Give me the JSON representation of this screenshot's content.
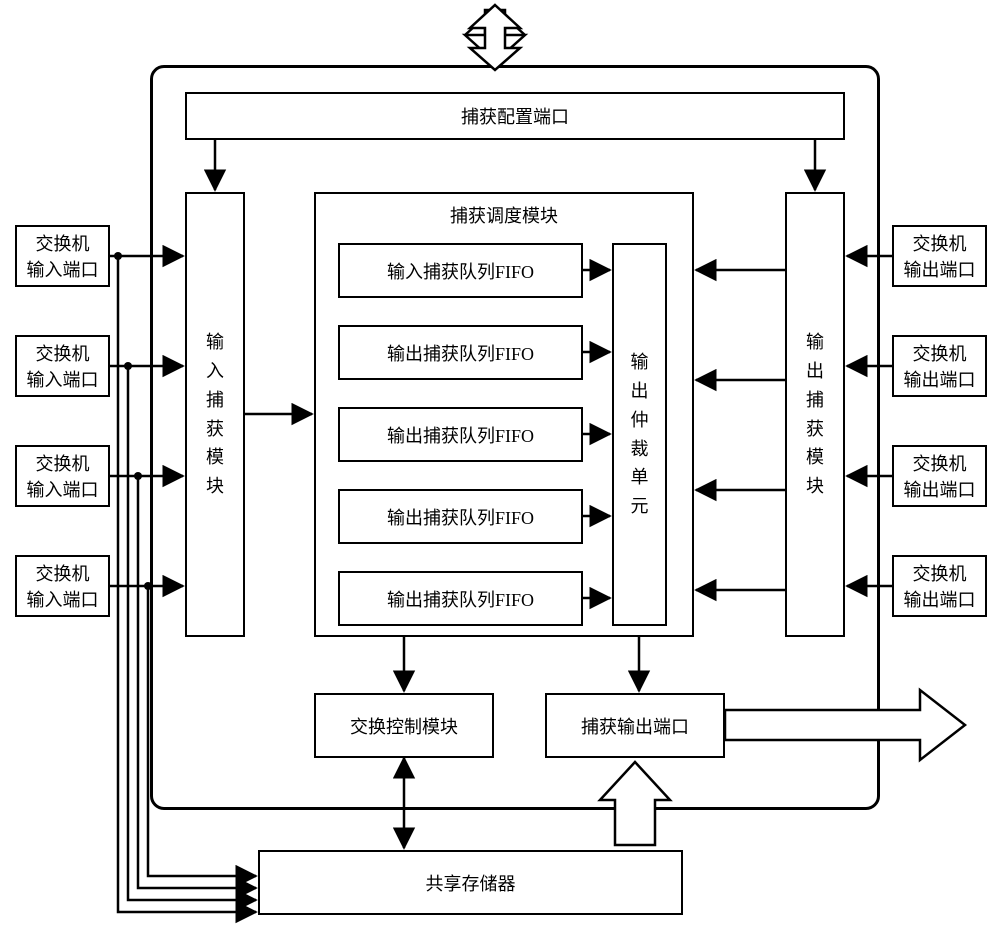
{
  "diagram": {
    "outer_container": "",
    "config_port": "捕获配置端口",
    "scheduler_title": "捕获调度模块",
    "input_capture_module": "输入捕获模块",
    "output_capture_module": "输出捕获模块",
    "arbiter": "输出仲裁单元",
    "fifo": {
      "f0": "输入捕获队列FIFO",
      "f1": "输出捕获队列FIFO",
      "f2": "输出捕获队列FIFO",
      "f3": "输出捕获队列FIFO",
      "f4": "输出捕获队列FIFO"
    },
    "exchange_control": "交换控制模块",
    "capture_output_port": "捕获输出端口",
    "shared_memory": "共享存储器",
    "in_port": {
      "p0": "交换机\n输入端口",
      "p1": "交换机\n输入端口",
      "p2": "交换机\n输入端口",
      "p3": "交换机\n输入端口"
    },
    "out_port": {
      "p0": "交换机\n输出端口",
      "p1": "交换机\n输出端口",
      "p2": "交换机\n输出端口",
      "p3": "交换机\n输出端口"
    }
  },
  "chart_data": null
}
